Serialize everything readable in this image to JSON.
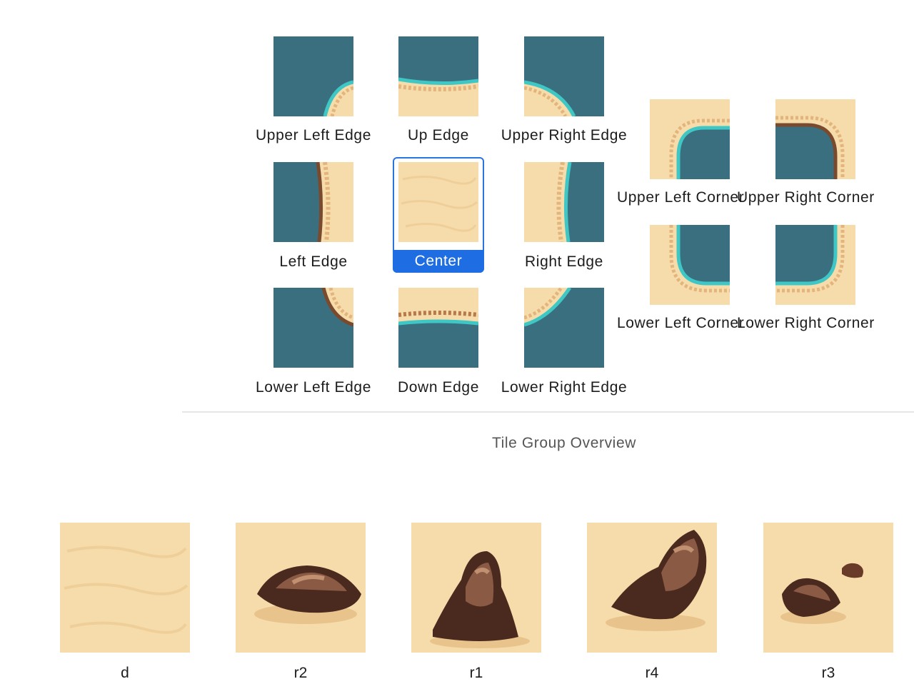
{
  "palette": {
    "water": "#3a6f80",
    "sand": "#f6dcaa",
    "sand_dark": "#e8c48c",
    "shore_brown": "#c98c56",
    "foam": "#3ec7c4",
    "selection": "#1e6de3",
    "rock_dark": "#4a2a1e",
    "rock_mid": "#8a5a44",
    "rock_light": "#c09070"
  },
  "adjacency_grid": {
    "upper_left_edge": {
      "label": "Upper Left Edge",
      "icon": "upper-left-edge-tile"
    },
    "up_edge": {
      "label": "Up Edge",
      "icon": "up-edge-tile"
    },
    "upper_right_edge": {
      "label": "Upper Right Edge",
      "icon": "upper-right-edge-tile"
    },
    "left_edge": {
      "label": "Left Edge",
      "icon": "left-edge-tile"
    },
    "center": {
      "label": "Center",
      "icon": "center-tile",
      "selected": true
    },
    "right_edge": {
      "label": "Right Edge",
      "icon": "right-edge-tile"
    },
    "lower_left_edge": {
      "label": "Lower Left Edge",
      "icon": "lower-left-edge-tile"
    },
    "down_edge": {
      "label": "Down Edge",
      "icon": "down-edge-tile"
    },
    "lower_right_edge": {
      "label": "Lower Right Edge",
      "icon": "lower-right-edge-tile"
    }
  },
  "corners": {
    "upper_left_corner": {
      "label": "Upper Left Corner",
      "icon": "upper-left-corner-tile"
    },
    "upper_right_corner": {
      "label": "Upper Right Corner",
      "icon": "upper-right-corner-tile"
    },
    "lower_left_corner": {
      "label": "Lower Left Corner",
      "icon": "lower-left-corner-tile"
    },
    "lower_right_corner": {
      "label": "Lower Right Corner",
      "icon": "lower-right-corner-tile"
    }
  },
  "overview": {
    "title": "Tile Group Overview"
  },
  "variants": [
    {
      "label": "d",
      "icon": "plain-sand-tile"
    },
    {
      "label": "r2",
      "icon": "rock-tile"
    },
    {
      "label": "r1",
      "icon": "rock-tile"
    },
    {
      "label": "r4",
      "icon": "rock-tile"
    },
    {
      "label": "r3",
      "icon": "rock-tile"
    }
  ]
}
